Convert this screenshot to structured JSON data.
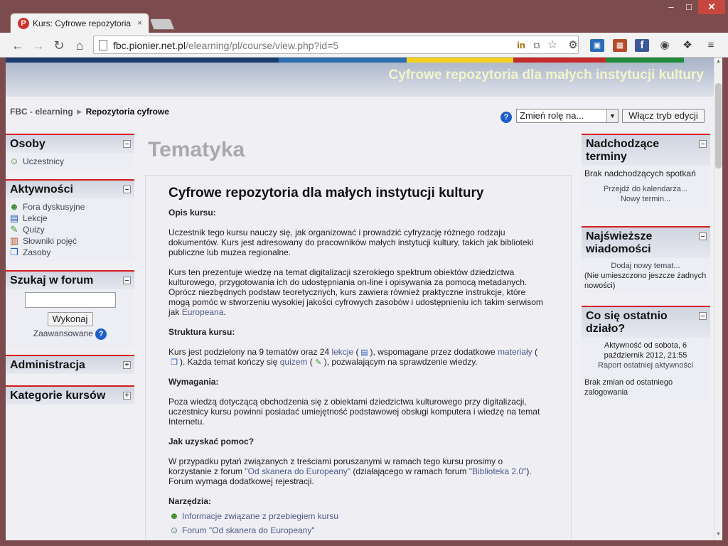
{
  "browser": {
    "tab_title": "Kurs: Cyfrowe repozytoria d",
    "tab_close": "×",
    "url_host": "fbc.pionier.net.pl",
    "url_path": "/elearning/pl/course/view.php?id=5",
    "win_min": "–",
    "win_max": "□",
    "win_close": "✕"
  },
  "header": {
    "site_title": "Cyfrowe repozytoria dla małych instytucji kultury",
    "breadcrumb_home": "FBC - elearning",
    "breadcrumb_sep": "►",
    "breadcrumb_current": "Repozytoria cyfrowe",
    "role_select": "Zmień rolę na...",
    "edit_button": "Włącz tryb edycji",
    "stripe_colors": [
      "#2e6fb0",
      "#f4d21c",
      "#c62b2b",
      "#1f8a3a",
      "#1a3c6e"
    ]
  },
  "left": {
    "osoby": {
      "title": "Osoby",
      "items": [
        {
          "label": "Uczestnicy",
          "icon": "users-icon"
        }
      ]
    },
    "aktywnosci": {
      "title": "Aktywności",
      "items": [
        {
          "label": "Fora dyskusyjne",
          "icon": "forum-icon"
        },
        {
          "label": "Lekcje",
          "icon": "lesson-icon"
        },
        {
          "label": "Quizy",
          "icon": "quiz-icon"
        },
        {
          "label": "Słowniki pojęć",
          "icon": "glossary-icon"
        },
        {
          "label": "Zasoby",
          "icon": "resource-icon"
        }
      ]
    },
    "szukaj": {
      "title": "Szukaj w forum",
      "button": "Wykonaj",
      "advanced": "Zaawansowane"
    },
    "admin": {
      "title": "Administracja"
    },
    "kategorie": {
      "title": "Kategorie kursów"
    },
    "toggle_minus": "–",
    "toggle_plus": "+"
  },
  "main": {
    "section_title": "Tematyka",
    "course_title": "Cyfrowe repozytoria dla małych instytucji kultury",
    "opis_label": "Opis kursu:",
    "opis_p1": "Uczestnik tego kursu nauczy się, jak organizować i prowadzić cyfryzację różnego rodzaju dokumentów. Kurs jest adresowany do pracowników małych instytucji kultury, takich jak biblioteki publiczne lub muzea regionalne.",
    "opis_p2_a": "Kurs ten prezentuje wiedzę na temat digitalizacji szerokiego spektrum obiektów dziedzictwa kulturowego, przygotowania ich do udostępniania on-line i opisywania za pomocą metadanych. Oprócz niezbędnych podstaw teoretycznych, kurs zawiera również praktyczne instrukcje, które mogą pomóc w stworzeniu wysokiej jakości cyfrowych zasobów i udostępnieniu ich takim serwisom jak ",
    "opis_p2_link": "Europeana",
    "opis_p2_end": ".",
    "struktura_label": "Struktura kursu:",
    "struktura_a": "Kurs jest podzielony na 9 tematów oraz 24 ",
    "struktura_lekcje": "lekcje",
    "struktura_b": " (",
    "struktura_c": "), wspomagane przez dodatkowe ",
    "struktura_materialy": "materiały",
    "struktura_d": " (",
    "struktura_e": "). Każda temat kończy się ",
    "struktura_quiz": "quizem",
    "struktura_f": " (",
    "struktura_g": "), pozwalającym na sprawdzenie wiedzy.",
    "wymagania_label": "Wymagania:",
    "wymagania_p": "Poza wiedzą dotyczącą obchodzenia się z obiektami dziedzictwa kulturowego przy digitalizacji, uczestnicy kursu powinni posiadać umiejętność podstawowej obsługi komputera i wiedzę na temat Internetu.",
    "pomoc_label": "Jak uzyskać pomoc?",
    "pomoc_a": "W przypadku pytań związanych z treściami poruszanymi w ramach tego kursu prosimy o korzystanie z forum ",
    "pomoc_link1": "\"Od skanera do Europeany\"",
    "pomoc_b": " (działającego w ramach forum ",
    "pomoc_link2": "\"Biblioteka 2.0\"",
    "pomoc_c": "). Forum wymaga dodatkowej rejestracji.",
    "narzedzia_label": "Narzędzia:",
    "tools": [
      {
        "label": "Informacje związane z przebiegiem kursu",
        "icon": "forum-icon"
      },
      {
        "label": "Forum \"Od skanera do Europeany\"",
        "icon": "chat-icon"
      }
    ]
  },
  "right": {
    "terminy": {
      "title_1": "Nadchodzące",
      "title_2": "terminy",
      "empty": "Brak nadchodzących spotkań",
      "link_calendar": "Przejdź do kalendarza...",
      "link_new": "Nowy termin..."
    },
    "wiadomosci": {
      "title_1": "Najświeższe",
      "title_2": "wiadomości",
      "add": "Dodaj nowy temat...",
      "empty": "(Nie umieszczono jeszcze żadnych nowości)"
    },
    "ostatnio": {
      "title_1": "Co się ostatnio",
      "title_2": "działo?",
      "activity": "Aktywność od sobota, 6 październik 2012, 21:55",
      "report": "Raport ostatniej aktywności",
      "no_changes": "Brak zmian od ostatniego zalogowania"
    }
  }
}
